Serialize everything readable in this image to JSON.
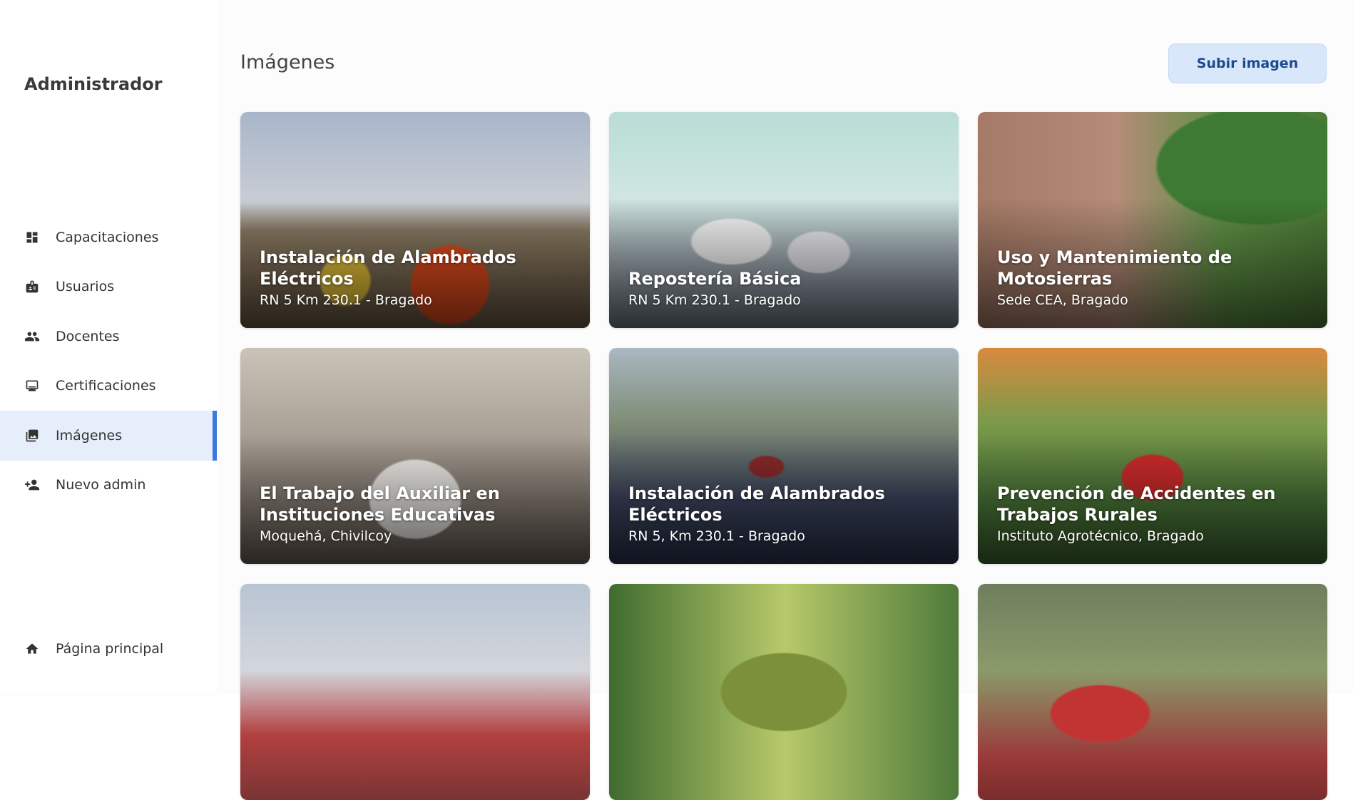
{
  "sidebar": {
    "brand": "Administrador",
    "items": [
      {
        "label": "Capacitaciones",
        "icon": "dashboard-icon",
        "active": false
      },
      {
        "label": "Usuarios",
        "icon": "badge-icon",
        "active": false
      },
      {
        "label": "Docentes",
        "icon": "people-icon",
        "active": false
      },
      {
        "label": "Certificaciones",
        "icon": "monitor-icon",
        "active": false
      },
      {
        "label": "Imágenes",
        "icon": "image-icon",
        "active": true
      },
      {
        "label": "Nuevo admin",
        "icon": "person-add-icon",
        "active": false
      }
    ],
    "home": {
      "label": "Página principal",
      "icon": "home-icon"
    }
  },
  "main": {
    "title": "Imágenes",
    "upload_label": "Subir imagen",
    "cards": [
      {
        "title": "Instalación de Alambrados Eléctricos",
        "subtitle": "RN 5 Km 230.1 - Bragado"
      },
      {
        "title": "Repostería Básica",
        "subtitle": "RN 5 Km 230.1 - Bragado"
      },
      {
        "title": "Uso y Mantenimiento de Motosierras",
        "subtitle": "Sede CEA, Bragado"
      },
      {
        "title": "El Trabajo del Auxiliar en Instituciones Educativas",
        "subtitle": "Moquehá, Chivilcoy"
      },
      {
        "title": "Instalación de Alambrados Eléctricos",
        "subtitle": "RN 5, Km 230.1 - Bragado"
      },
      {
        "title": "Prevención de Accidentes en Trabajos Rurales",
        "subtitle": "Instituto Agrotécnico, Bragado"
      },
      {
        "title": "",
        "subtitle": ""
      },
      {
        "title": "",
        "subtitle": ""
      },
      {
        "title": "",
        "subtitle": ""
      }
    ]
  },
  "colors": {
    "accent": "#3a78e0",
    "active_bg": "#e6eefb",
    "button_bg": "#d9e7fb",
    "button_text": "#1d4a8a"
  }
}
